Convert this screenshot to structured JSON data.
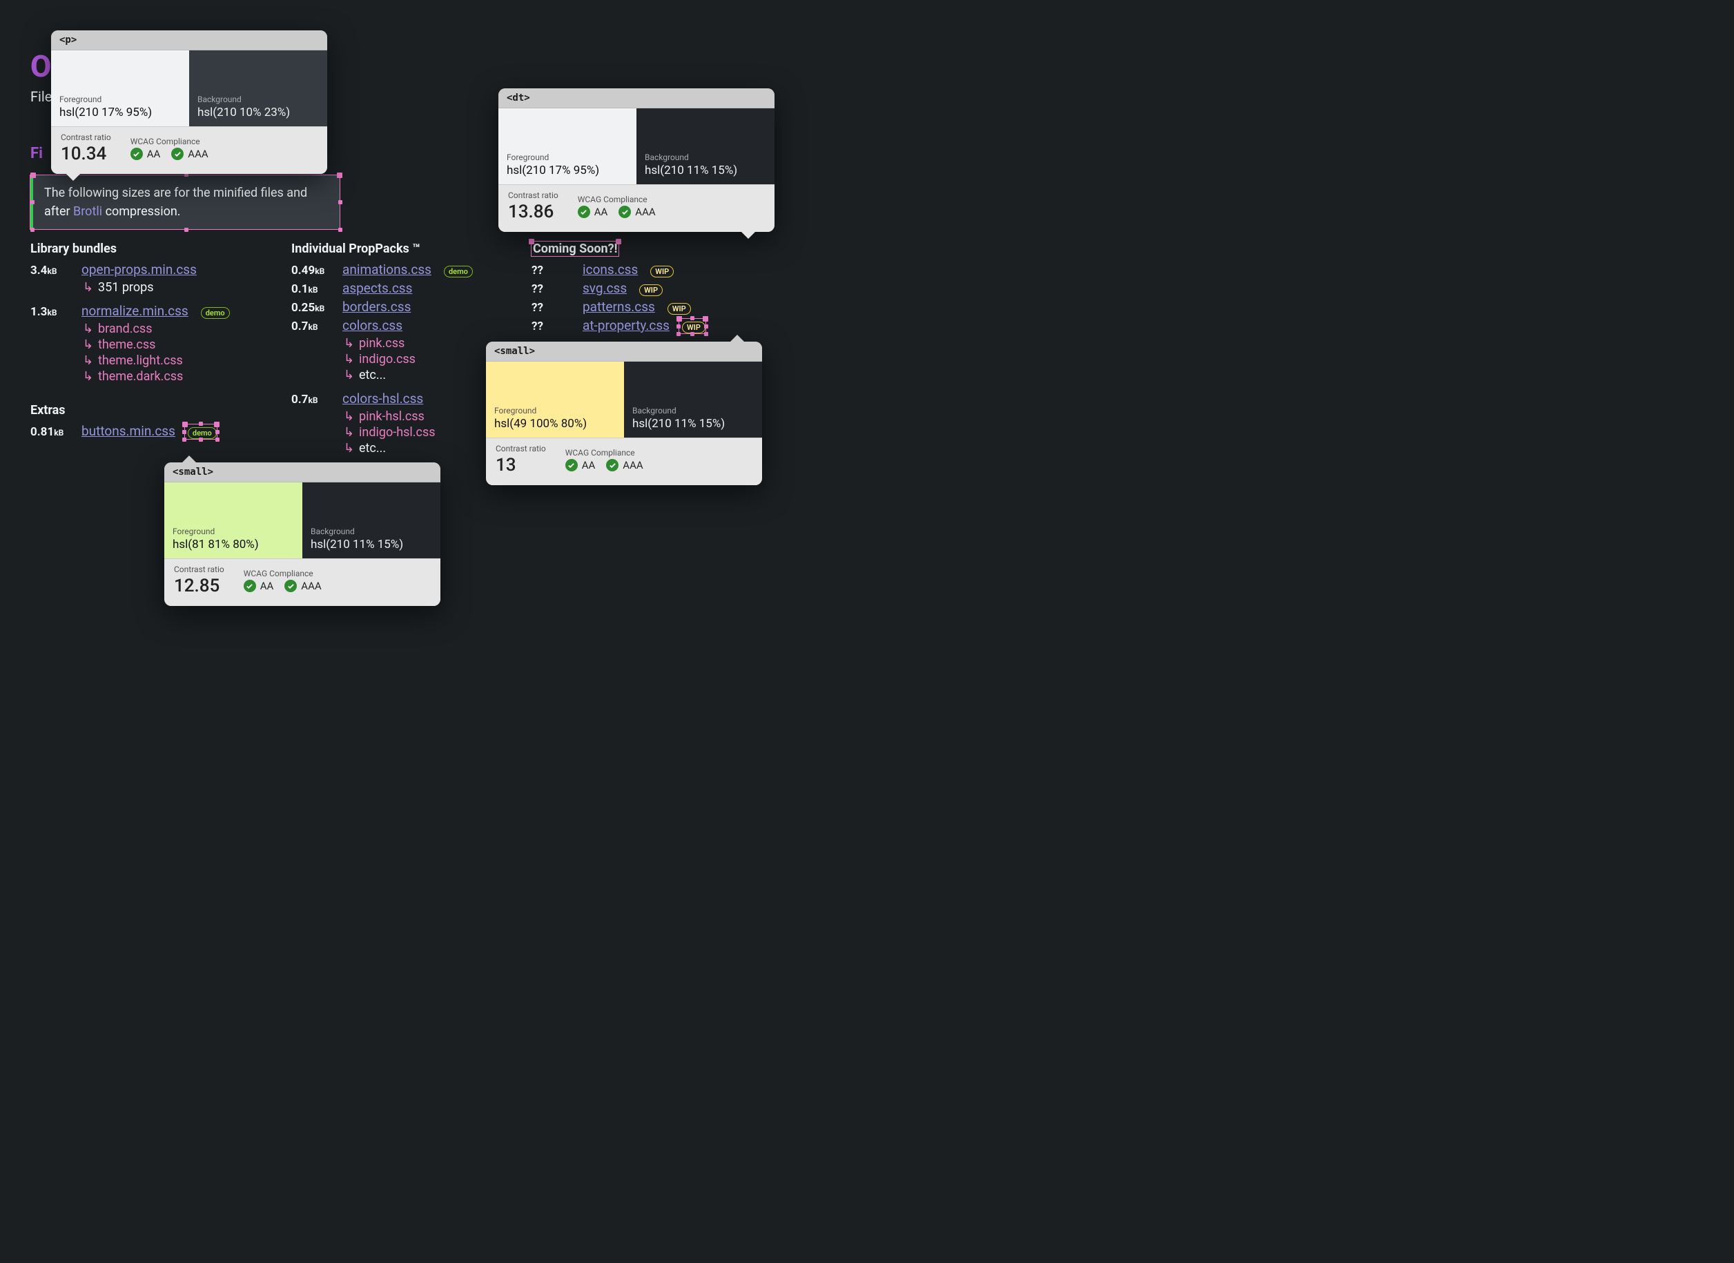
{
  "page": {
    "title_stub": "O",
    "subtitle_stub": "File",
    "section_stub": "Fi"
  },
  "callout": {
    "text_before": "The following sizes are for the minified files and after ",
    "link": "Brotli",
    "text_after": " compression."
  },
  "columns": {
    "library": {
      "heading": "Library bundles",
      "rows": [
        {
          "size": "3.4",
          "unit": "kB",
          "name": "open-props.min.css",
          "subs": [
            {
              "text": "351 props",
              "muted": true
            }
          ]
        },
        {
          "size": "1.3",
          "unit": "kB",
          "name": "normalize.min.css",
          "badge": "demo",
          "subs": [
            {
              "text": "brand.css"
            },
            {
              "text": "theme.css"
            },
            {
              "text": "theme.light.css"
            },
            {
              "text": "theme.dark.css"
            }
          ]
        }
      ]
    },
    "extras": {
      "heading": "Extras",
      "rows": [
        {
          "size": "0.81",
          "unit": "kB",
          "name": "buttons.min.css",
          "badge": "demo",
          "badge_selected": true
        }
      ]
    },
    "packs": {
      "heading": "Individual PropPacks ™",
      "rows": [
        {
          "size": "0.49",
          "unit": "kB",
          "name": "animations.css",
          "badge": "demo"
        },
        {
          "size": "0.1",
          "unit": "kB",
          "name": "aspects.css"
        },
        {
          "size": "0.25",
          "unit": "kB",
          "name": "borders.css"
        },
        {
          "size": "0.7",
          "unit": "kB",
          "name": "colors.css",
          "subs": [
            {
              "text": "pink.css"
            },
            {
              "text": "indigo.css"
            },
            {
              "text": "etc...",
              "muted": true
            }
          ]
        },
        {
          "size": "0.7",
          "unit": "kB",
          "name": "colors-hsl.css",
          "subs": [
            {
              "text": "pink-hsl.css"
            },
            {
              "text": "indigo-hsl.css"
            },
            {
              "text": "etc...",
              "muted": true
            }
          ]
        }
      ]
    },
    "coming": {
      "heading": "Coming Soon?!",
      "rows": [
        {
          "size": "??",
          "unit": "",
          "name": "icons.css",
          "badge": "WIP"
        },
        {
          "size": "??",
          "unit": "",
          "name": "svg.css",
          "badge": "WIP"
        },
        {
          "size": "??",
          "unit": "",
          "name": "patterns.css",
          "badge": "WIP"
        },
        {
          "size": "??",
          "unit": "",
          "name": "at-property.css",
          "badge": "WIP",
          "badge_selected": true
        }
      ]
    }
  },
  "tooltips": {
    "p": {
      "tag": "<p>",
      "fg_label": "Foreground",
      "fg_value": "hsl(210 17% 95%)",
      "fg_color": "hsl(210 17% 95%)",
      "bg_label": "Background",
      "bg_value": "hsl(210 10% 23%)",
      "bg_color": "hsl(210 10% 23%)",
      "ratio_label": "Contrast ratio",
      "ratio": "10.34",
      "wcag_label": "WCAG Compliance",
      "aa": "AA",
      "aaa": "AAA"
    },
    "dt": {
      "tag": "<dt>",
      "fg_label": "Foreground",
      "fg_value": "hsl(210 17% 95%)",
      "fg_color": "hsl(210 17% 95%)",
      "bg_label": "Background",
      "bg_value": "hsl(210 11% 15%)",
      "bg_color": "hsl(210 11% 15%)",
      "ratio_label": "Contrast ratio",
      "ratio": "13.86",
      "wcag_label": "WCAG Compliance",
      "aa": "AA",
      "aaa": "AAA"
    },
    "small1": {
      "tag": "<small>",
      "fg_label": "Foreground",
      "fg_value": "hsl(49 100% 80%)",
      "fg_color": "hsl(49 100% 80%)",
      "bg_label": "Background",
      "bg_value": "hsl(210 11% 15%)",
      "bg_color": "hsl(210 11% 15%)",
      "ratio_label": "Contrast ratio",
      "ratio": "13",
      "wcag_label": "WCAG Compliance",
      "aa": "AA",
      "aaa": "AAA"
    },
    "small2": {
      "tag": "<small>",
      "fg_label": "Foreground",
      "fg_value": "hsl(81 81% 80%)",
      "fg_color": "hsl(81 81% 80%)",
      "bg_label": "Background",
      "bg_value": "hsl(210 11% 15%)",
      "bg_color": "hsl(210 11% 15%)",
      "ratio_label": "Contrast ratio",
      "ratio": "12.85",
      "wcag_label": "WCAG Compliance",
      "aa": "AA",
      "aaa": "AAA"
    }
  }
}
